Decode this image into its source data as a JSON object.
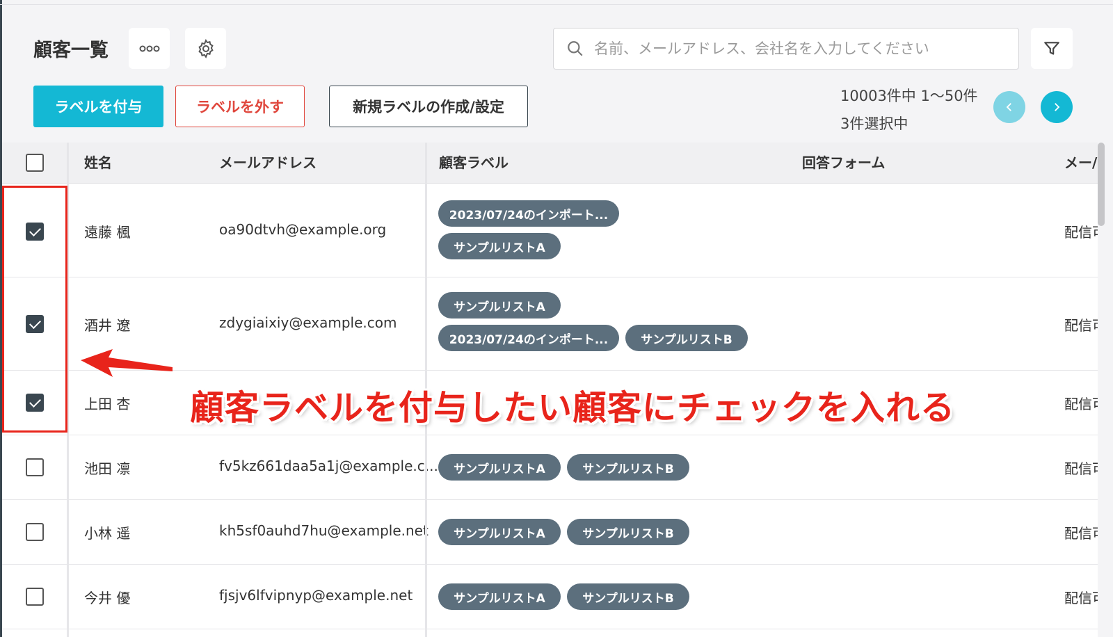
{
  "header": {
    "title": "顧客一覧",
    "more_icon": "more-dots-icon",
    "settings_icon": "gear-icon",
    "search": {
      "placeholder": "名前、メールアドレス、会社名を入力してください",
      "value": ""
    },
    "filter_icon": "filter-icon"
  },
  "toolbar": {
    "add_label": "ラベルを付与",
    "remove_label": "ラベルを外す",
    "new_label": "新規ラベルの作成/設定",
    "count_text": "10003件中 1〜50件",
    "selected_text": "3件選択中",
    "prev_icon": "chevron-left-icon",
    "next_icon": "chevron-right-icon"
  },
  "colors": {
    "accent": "#14b8d4",
    "danger": "#e0473d",
    "tag": "#5c6f7d",
    "annotation": "#e8241b"
  },
  "table": {
    "columns": [
      "姓名",
      "メールアドレス",
      "顧客ラベル",
      "回答フォーム",
      "メー/"
    ],
    "rows": [
      {
        "checked": true,
        "name": "遠藤 楓",
        "email": "oa90dtvh@example.org",
        "labels": [
          "2023/07/24のインポート...",
          "サンプルリストA"
        ],
        "delivery": "配信可"
      },
      {
        "checked": true,
        "name": "酒井 遼",
        "email": "zdygiaixiy@example.com",
        "labels": [
          "サンプルリストA",
          "2023/07/24のインポート...",
          "サンプルリストB"
        ],
        "delivery": "配信可"
      },
      {
        "checked": true,
        "name": "上田 杏",
        "email": "",
        "labels": [],
        "delivery": "配信可"
      },
      {
        "checked": false,
        "name": "池田 凛",
        "email": "fv5kz661daa5a1j@example.c...",
        "labels": [
          "サンプルリストA",
          "サンプルリストB"
        ],
        "delivery": "配信可"
      },
      {
        "checked": false,
        "name": "小林 遥",
        "email": "kh5sf0auhd7hu@example.net",
        "labels": [
          "サンプルリストA",
          "サンプルリストB"
        ],
        "delivery": "配信可"
      },
      {
        "checked": false,
        "name": "今井 優",
        "email": "fjsjv6lfvipnyp@example.net",
        "labels": [
          "サンプルリストA",
          "サンプルリストB"
        ],
        "delivery": "配信可"
      }
    ]
  },
  "annotation": {
    "text": "顧客ラベルを付与したい顧客にチェックを入れる",
    "arrow_icon": "arrow-left-icon"
  }
}
